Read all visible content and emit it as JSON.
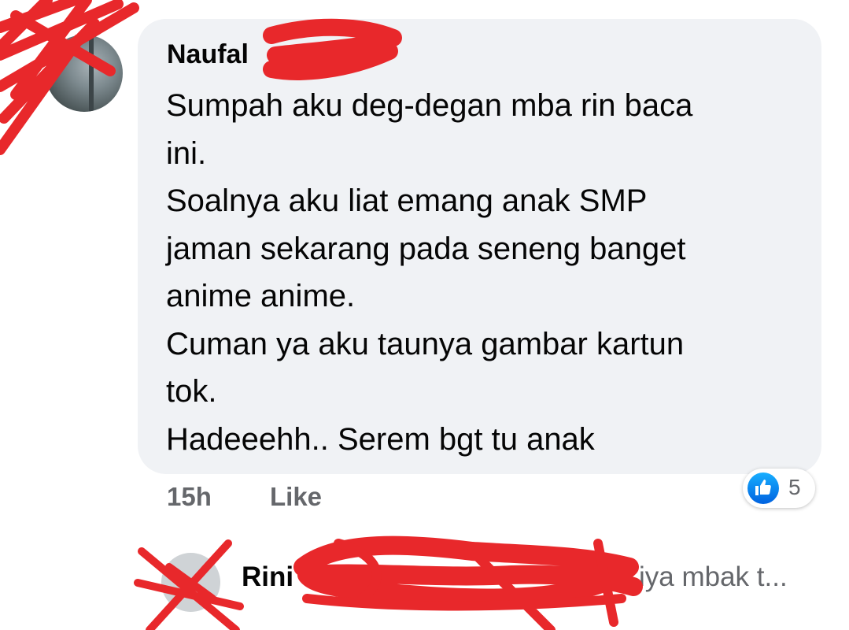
{
  "comment": {
    "author": "Naufal",
    "lines": [
      "Sumpah aku deg-degan mba rin baca",
      "ini.",
      "Soalnya aku liat emang anak SMP",
      "jaman sekarang pada seneng banget",
      "anime anime.",
      "Cuman ya aku taunya gambar kartun",
      "tok.",
      "Hadeeehh.. Serem bgt tu anak"
    ],
    "time": "15h",
    "like_label": "Like",
    "reaction_count": "5",
    "reaction_icon": "like-icon"
  },
  "reply": {
    "author": "Rini",
    "snippet": "iya mbak t..."
  },
  "colors": {
    "bubble": "#f0f2f5",
    "meta_text": "#65676b",
    "like_blue": "#0866ff",
    "redaction": "#e8282b"
  }
}
